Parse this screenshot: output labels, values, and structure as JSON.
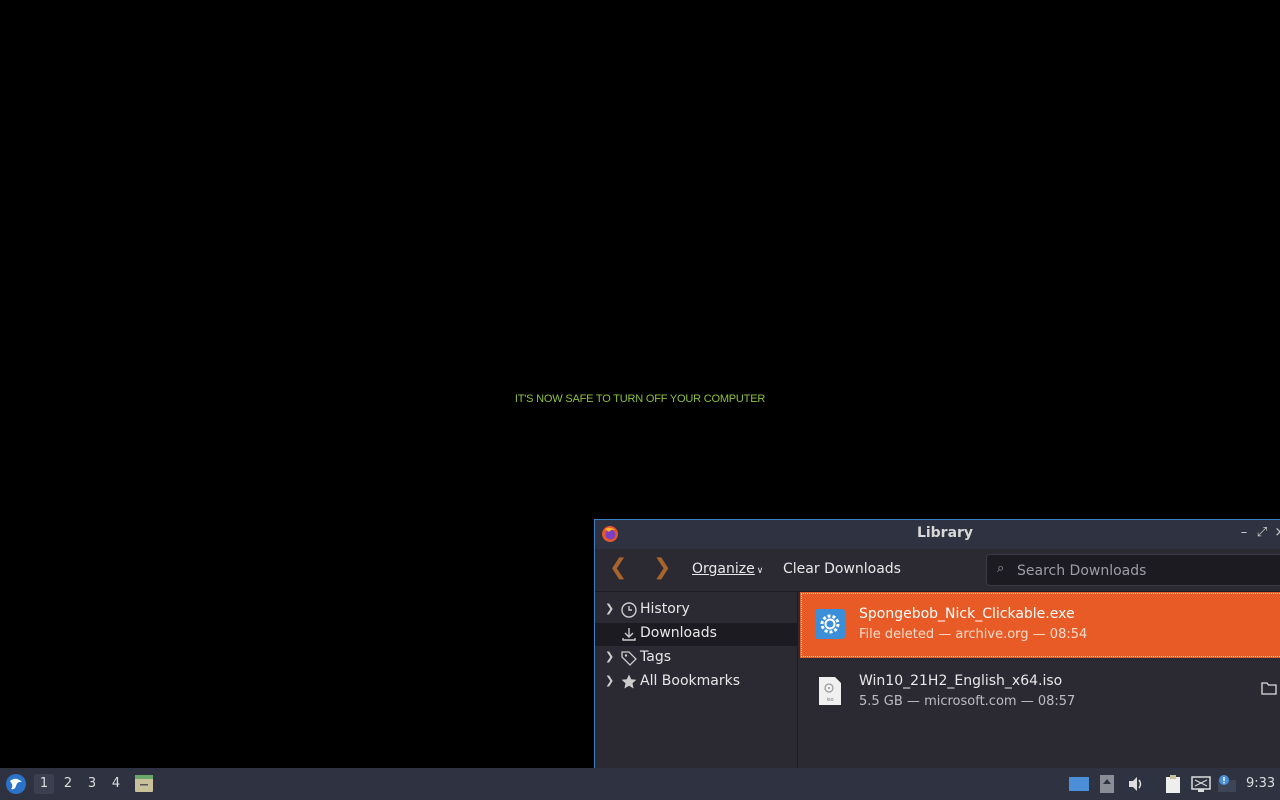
{
  "desktop": {
    "message": "IT'S NOW SAFE TO TURN OFF YOUR COMPUTER"
  },
  "window": {
    "title": "Library",
    "controls": {
      "minimize": "–",
      "maximize": "⤢",
      "close": "×"
    }
  },
  "toolbar": {
    "back_label": "❮",
    "forward_label": "❯",
    "organize_label": "Organize",
    "clear_label": "Clear Downloads",
    "search_placeholder": "Search Downloads"
  },
  "sidebar": {
    "items": [
      {
        "label": "History",
        "expandable": true,
        "icon": "clock-icon"
      },
      {
        "label": "Downloads",
        "expandable": false,
        "icon": "download-icon",
        "selected": true
      },
      {
        "label": "Tags",
        "expandable": true,
        "icon": "tag-icon"
      },
      {
        "label": "All Bookmarks",
        "expandable": true,
        "icon": "star-icon"
      }
    ]
  },
  "downloads": [
    {
      "name": "Spongebob_Nick_Clickable.exe",
      "meta": "File deleted — archive.org — 08:54",
      "icon": "gear-icon",
      "selected": true
    },
    {
      "name": "Win10_21H2_English_x64.iso",
      "meta": "5.5 GB — microsoft.com — 08:57",
      "icon": "iso-file-icon",
      "selected": false
    }
  ],
  "taskbar": {
    "workspaces": [
      "1",
      "2",
      "3",
      "4"
    ],
    "active_workspace": "1",
    "clock": "9:33"
  },
  "colors": {
    "accent": "#e95b26",
    "window_border": "#3d7fc4",
    "message_green": "#8fbf3f"
  }
}
